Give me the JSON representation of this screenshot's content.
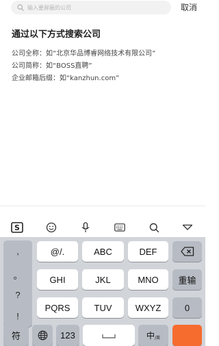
{
  "search": {
    "placeholder": "输入要屏蔽的公司",
    "cancel_label": "取消"
  },
  "guide": {
    "title": "通过以下方式搜索公司",
    "lines": [
      "公司全称：如“北京华品博睿网络技术有限公司”",
      "公司简称：如“BOSS直聘”",
      "企业邮箱后缀：如“kanzhun.com”"
    ]
  },
  "ime_toolbar": {
    "icons": [
      "sogou-logo-icon",
      "emoji-icon",
      "microphone-icon",
      "keyboard-icon",
      "search-icon",
      "collapse-icon"
    ],
    "logo_letter": "S"
  },
  "keyboard": {
    "punctuation": [
      ",",
      "。",
      "?",
      "!"
    ],
    "letter_keys": [
      [
        "@/.",
        "ABC",
        "DEF"
      ],
      [
        "GHI",
        "JKL",
        "MNO"
      ],
      [
        "PQRS",
        "TUV",
        "WXYZ"
      ]
    ],
    "side_keys": {
      "delete_icon": "backspace-icon",
      "retype": "重输",
      "zero": "0"
    },
    "bottom_row": {
      "symbol": "符",
      "globe_icon": "globe-icon",
      "numeric": "123",
      "space_icon": "space-icon",
      "lang": "中",
      "lang_sub": "/英",
      "enter_color": "#f66b2e"
    }
  }
}
